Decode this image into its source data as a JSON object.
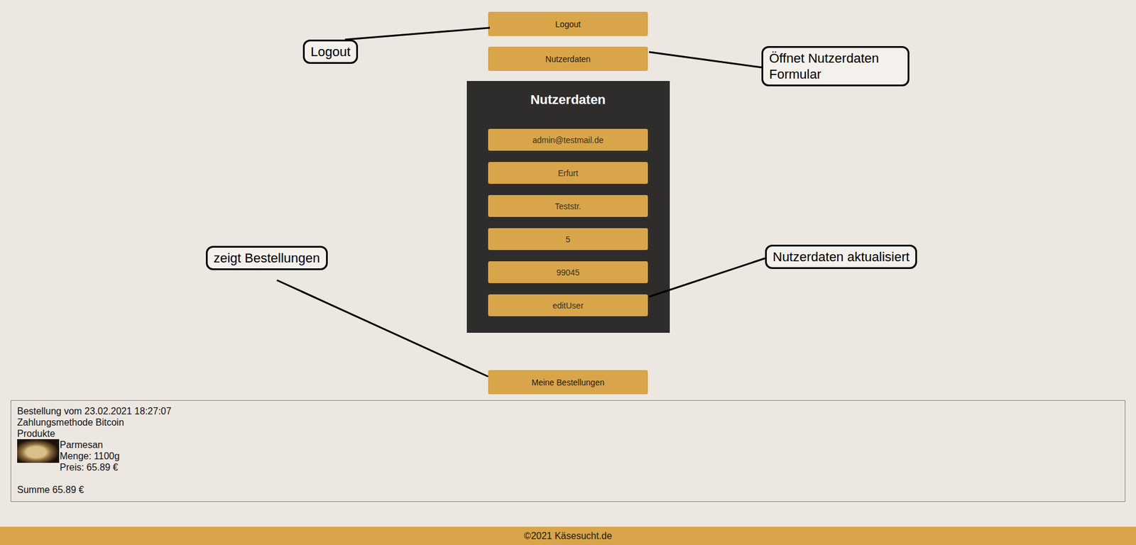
{
  "nav": [
    {
      "label": "Logout"
    },
    {
      "label": "Nutzerdaten"
    }
  ],
  "user_form": {
    "title": "Nutzerdaten",
    "fields": [
      "admin@testmail.de",
      "Erfurt",
      "Teststr.",
      "5",
      "99045"
    ],
    "submit": "editUser"
  },
  "orders_button": "Meine Bestellungen",
  "orders": [
    {
      "date_line": "Bestellung vom 23.02.2021 18:27:07",
      "payment": "Zahlungsmethode Bitcoin",
      "products_label": "Produkte",
      "products": [
        {
          "name": "Parmesan",
          "quantity": "Menge: 1100g",
          "price": "Preis: 65.89 €"
        }
      ],
      "total": "Summe 65.89 €"
    }
  ],
  "annotations": [
    {
      "text": "Logout"
    },
    {
      "text": "Öffnet Nutzerdaten Formular"
    },
    {
      "text": "zeigt Bestellungen"
    },
    {
      "text": "Nutzerdaten aktualisiert"
    }
  ],
  "footer": "©2021 Käsesucht.de"
}
